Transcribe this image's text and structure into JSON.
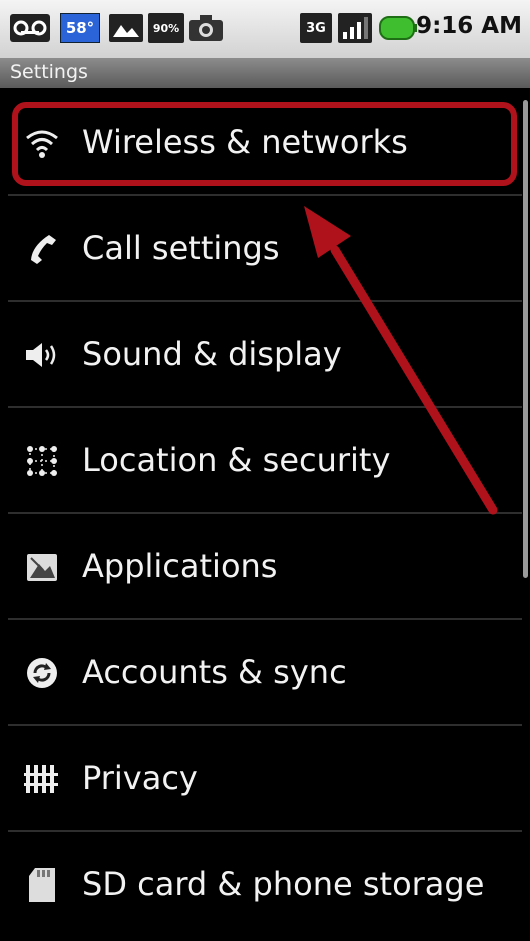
{
  "status_bar": {
    "clock": "9:16 AM",
    "temperature": "58°",
    "battery_percent_label": "90%",
    "network": "3G",
    "accent": "#3fbf2f"
  },
  "header": {
    "title": "Settings"
  },
  "settings": {
    "items": [
      {
        "label": "Wireless & networks",
        "icon": "wifi-icon"
      },
      {
        "label": "Call settings",
        "icon": "phone-icon"
      },
      {
        "label": "Sound & display",
        "icon": "speaker-icon"
      },
      {
        "label": "Location & security",
        "icon": "location-grid-icon"
      },
      {
        "label": "Applications",
        "icon": "applications-icon"
      },
      {
        "label": "Accounts & sync",
        "icon": "sync-icon"
      },
      {
        "label": "Privacy",
        "icon": "privacy-icon"
      },
      {
        "label": "SD card & phone storage",
        "icon": "sd-card-icon"
      }
    ]
  },
  "annotation": {
    "highlighted_item": "Wireless & networks",
    "color": "#b0121c"
  }
}
